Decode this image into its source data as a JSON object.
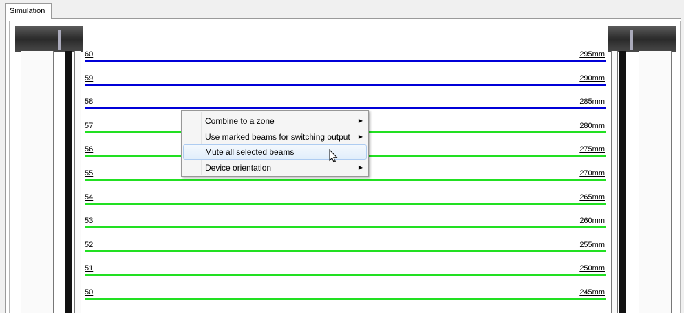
{
  "tab": {
    "label": "Simulation"
  },
  "beams": [
    {
      "num": "60",
      "mm": "295mm",
      "color": "#0000d8"
    },
    {
      "num": "59",
      "mm": "290mm",
      "color": "#0000d8"
    },
    {
      "num": "58",
      "mm": "285mm",
      "color": "#0000d8"
    },
    {
      "num": "57",
      "mm": "280mm",
      "color": "#22e022"
    },
    {
      "num": "56",
      "mm": "275mm",
      "color": "#22e022"
    },
    {
      "num": "55",
      "mm": "270mm",
      "color": "#22e022"
    },
    {
      "num": "54",
      "mm": "265mm",
      "color": "#22e022"
    },
    {
      "num": "53",
      "mm": "260mm",
      "color": "#22e022"
    },
    {
      "num": "52",
      "mm": "255mm",
      "color": "#22e022"
    },
    {
      "num": "51",
      "mm": "250mm",
      "color": "#22e022"
    },
    {
      "num": "50",
      "mm": "245mm",
      "color": "#22e022"
    }
  ],
  "context_menu": {
    "items": [
      {
        "label": "Combine to a zone",
        "submenu": true
      },
      {
        "label": "Use marked beams for switching output",
        "submenu": true
      },
      {
        "label": "Mute all selected beams",
        "submenu": false,
        "highlighted": true
      },
      {
        "label": "Device orientation",
        "submenu": true
      }
    ]
  }
}
